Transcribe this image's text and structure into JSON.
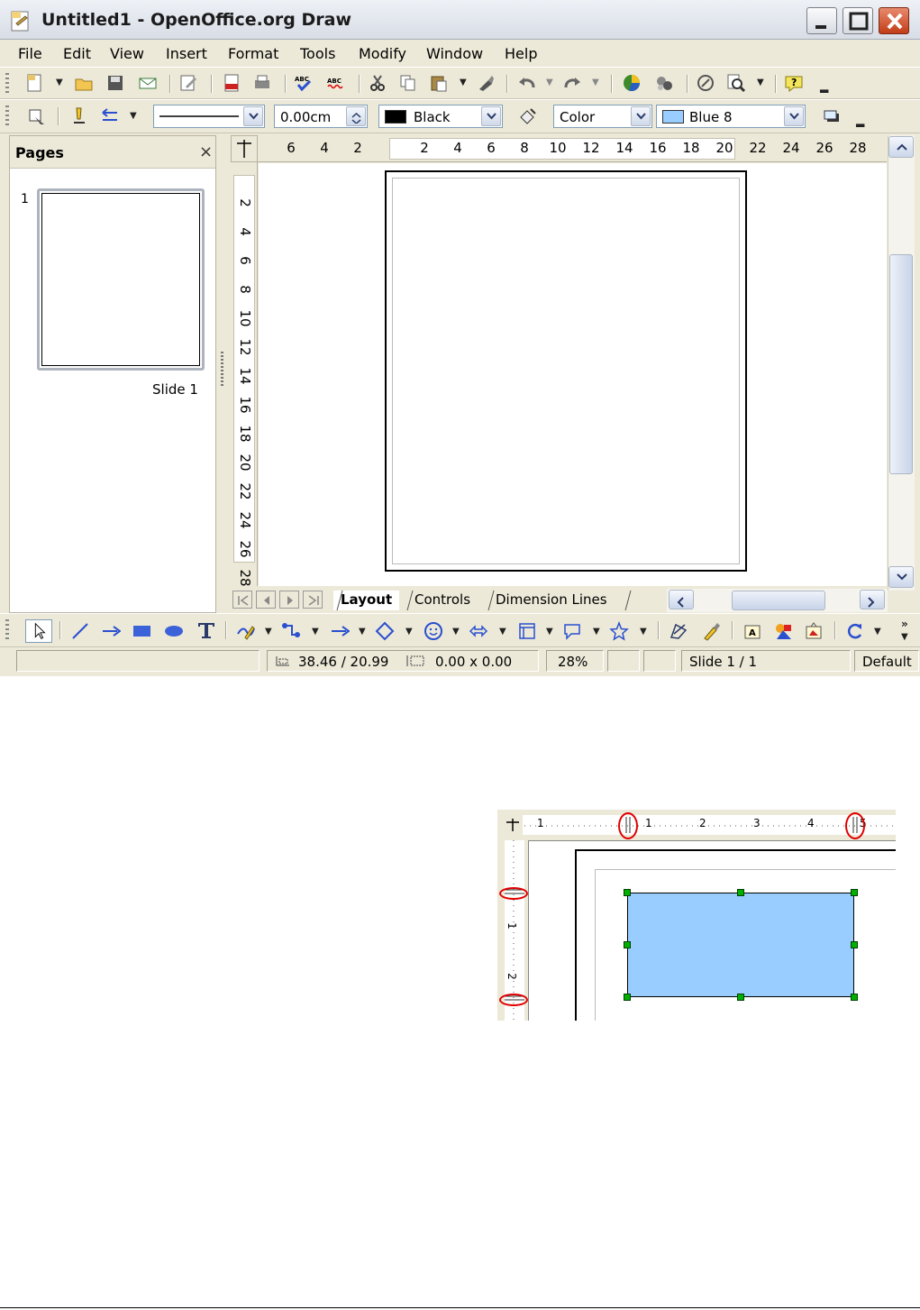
{
  "window": {
    "title": "Untitled1 - OpenOffice.org Draw"
  },
  "menu": {
    "items": [
      {
        "label": "File"
      },
      {
        "label": "Edit"
      },
      {
        "label": "View"
      },
      {
        "label": "Insert"
      },
      {
        "label": "Format"
      },
      {
        "label": "Tools"
      },
      {
        "label": "Modify"
      },
      {
        "label": "Window"
      },
      {
        "label": "Help"
      }
    ]
  },
  "line_toolbar": {
    "line_width": "0.00cm",
    "line_color": "Black",
    "area_style": "Color",
    "area_color": "Blue 8"
  },
  "pages_pane": {
    "title": "Pages",
    "close_glyph": "×",
    "page_number": "1",
    "slide_label": "Slide 1"
  },
  "hruler": {
    "ticks": [
      "6",
      "4",
      "2",
      "2",
      "4",
      "6",
      "8",
      "10",
      "12",
      "14",
      "16",
      "18",
      "20",
      "22",
      "24",
      "26",
      "28"
    ]
  },
  "vruler": {
    "ticks": [
      "2",
      "4",
      "6",
      "8",
      "10",
      "12",
      "14",
      "16",
      "18",
      "20",
      "22",
      "24",
      "26",
      "28"
    ]
  },
  "tabs": {
    "layout": "Layout",
    "controls": "Controls",
    "dimension_lines": "Dimension Lines"
  },
  "status": {
    "position": "38.46 / 20.99",
    "size": "0.00 x 0.00",
    "zoom": "28%",
    "slide": "Slide 1 / 1",
    "style": "Default"
  },
  "inset": {
    "hruler_ticks": [
      "1",
      "1",
      "2",
      "3",
      "4",
      "5"
    ],
    "vruler_ticks": [
      "1",
      "2"
    ]
  },
  "colors": {
    "chrome": "#ece9d8",
    "shape_fill": "#99ccff",
    "handle": "#00b000",
    "highlight_ring": "#e00000"
  }
}
